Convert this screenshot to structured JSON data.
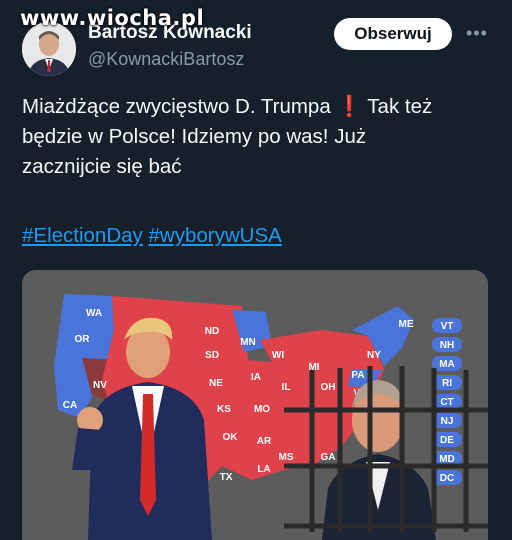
{
  "watermark": "www.wiocha.pl",
  "author": {
    "name": "Bartosz Kownacki",
    "handle": "@KownackiBartosz"
  },
  "follow_label": "Obserwuj",
  "tweet": {
    "line1_a": "Miażdżące zwycięstwo D. Trumpa",
    "line1_icon": "❗",
    "line1_b": " Tak też",
    "line2": "będzie w Polsce! Idziemy po was! Już",
    "line3": "zacznijcie się bać"
  },
  "hashtags": [
    "#ElectionDay",
    "#wyborywUSA"
  ],
  "map": {
    "colors": {
      "red": "#e0424a",
      "blue": "#4a74d9",
      "dark_red": "#8a3a3a",
      "bg": "#5c5c5c",
      "bubble": "#4a74d9"
    },
    "state_labels": [
      "WA",
      "OR",
      "CA",
      "NV",
      "ND",
      "SD",
      "NE",
      "KS",
      "OK",
      "TX",
      "MN",
      "IA",
      "MO",
      "AR",
      "LA",
      "WI",
      "IL",
      "MI",
      "OH",
      "PA",
      "NY",
      "ME",
      "MS",
      "GA",
      "VA"
    ],
    "east_bubbles": [
      "VT",
      "NH",
      "MA",
      "RI",
      "CT",
      "NJ",
      "DE",
      "MD",
      "DC"
    ]
  },
  "icons": {
    "more": "more-horizontal-icon",
    "exclamation": "red-exclamation-icon"
  }
}
